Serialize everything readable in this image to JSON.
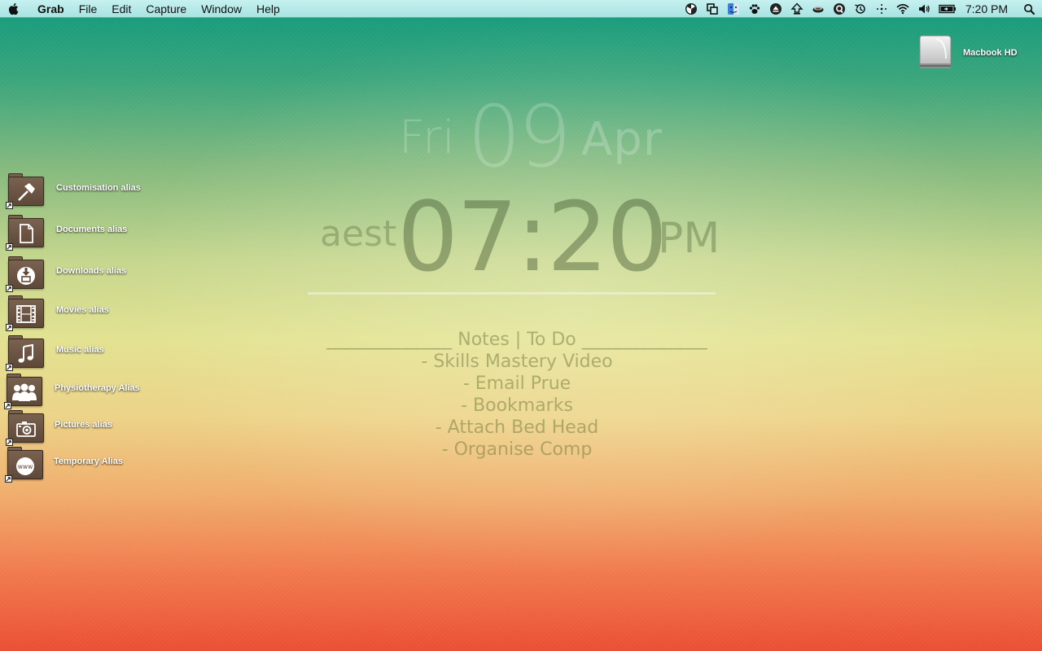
{
  "menubar": {
    "app_name": "Grab",
    "menus": [
      "File",
      "Edit",
      "Capture",
      "Window",
      "Help"
    ],
    "tray_icons": [
      "radiation-icon",
      "copy-windows-icon",
      "finder-face-icon",
      "pawprint-icon",
      "eject-icon",
      "upload-icon",
      "coffee-cup-icon",
      "quicksilver-icon",
      "time-machine-icon",
      "network-dots-icon",
      "wifi-icon",
      "volume-icon",
      "battery-icon"
    ],
    "clock": "7:20 PM"
  },
  "desktop": {
    "drive": {
      "label": "Macbook HD"
    },
    "aliases": [
      {
        "label": "Customisation alias",
        "icon": "hammer-icon"
      },
      {
        "label": "Documents alias",
        "icon": "document-icon"
      },
      {
        "label": "Downloads alias",
        "icon": "download-icon"
      },
      {
        "label": "Movies alias",
        "icon": "film-icon"
      },
      {
        "label": "Music alias",
        "icon": "music-note-icon"
      },
      {
        "label": "Physiotherapy Alias",
        "icon": "people-icon"
      },
      {
        "label": "Pictures alias",
        "icon": "camera-icon"
      },
      {
        "label": "Temporary Alias",
        "icon": "www-icon"
      }
    ]
  },
  "clock_widget": {
    "day": "Fri",
    "date": "09",
    "month": "Apr",
    "timezone": "aest",
    "time": "07:20",
    "ampm": "PM"
  },
  "notes": {
    "heading": "______________ Notes | To Do ______________",
    "items": [
      "- Skills Mastery Video",
      "- Email Prue",
      "- Bookmarks",
      "- Attach Bed Head",
      "- Organise Comp"
    ]
  },
  "colors": {
    "menubar_top": "#c6f1f0",
    "wallpaper_top": "#0f9a7c",
    "wallpaper_mid": "#e2e291",
    "wallpaper_bottom": "#ea4f34",
    "folder_brown": "#6b5443"
  }
}
